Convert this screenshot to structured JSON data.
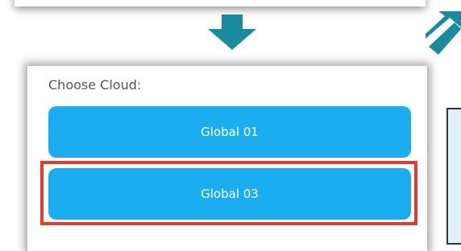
{
  "panel": {
    "label": "Choose Cloud:",
    "options": [
      {
        "label": "Global 01"
      },
      {
        "label": "Global 03"
      }
    ]
  },
  "colors": {
    "button": "#1aaef0",
    "arrow": "#1a8b9e",
    "highlight": "#e53a2f"
  }
}
